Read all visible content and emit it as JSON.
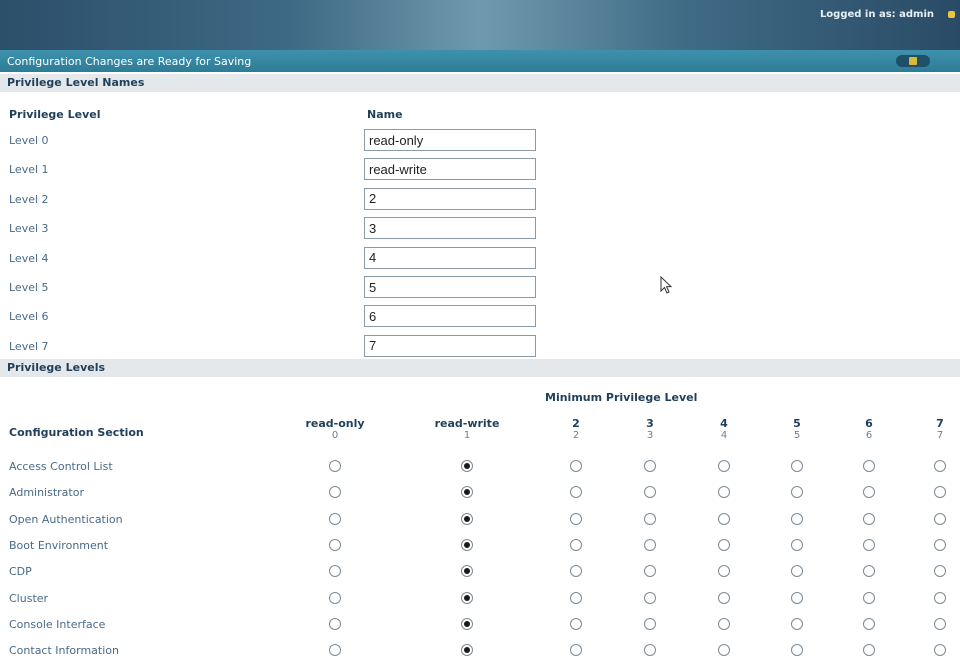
{
  "header": {
    "logged_in": "Logged in as: admin"
  },
  "banner": {
    "text": "Configuration Changes are Ready for Saving"
  },
  "names_section": {
    "title": "Privilege Level Names",
    "col_level": "Privilege Level",
    "col_name": "Name",
    "rows": [
      {
        "label": "Level 0",
        "value": "read-only"
      },
      {
        "label": "Level 1",
        "value": "read-write"
      },
      {
        "label": "Level 2",
        "value": "2"
      },
      {
        "label": "Level 3",
        "value": "3"
      },
      {
        "label": "Level 4",
        "value": "4"
      },
      {
        "label": "Level 5",
        "value": "5"
      },
      {
        "label": "Level 6",
        "value": "6"
      },
      {
        "label": "Level 7",
        "value": "7"
      }
    ]
  },
  "levels_section": {
    "title": "Privilege Levels",
    "min_title": "Minimum Privilege Level",
    "col_config": "Configuration Section",
    "levels": [
      {
        "name": "read-only",
        "num": "0"
      },
      {
        "name": "read-write",
        "num": "1"
      },
      {
        "name": "2",
        "num": "2"
      },
      {
        "name": "3",
        "num": "3"
      },
      {
        "name": "4",
        "num": "4"
      },
      {
        "name": "5",
        "num": "5"
      },
      {
        "name": "6",
        "num": "6"
      },
      {
        "name": "7",
        "num": "7"
      }
    ],
    "rows": [
      {
        "label": "Access Control List",
        "selected": 1
      },
      {
        "label": "Administrator",
        "selected": 1
      },
      {
        "label": "Open Authentication",
        "selected": 1
      },
      {
        "label": "Boot Environment",
        "selected": 1
      },
      {
        "label": "CDP",
        "selected": 1
      },
      {
        "label": "Cluster",
        "selected": 1
      },
      {
        "label": "Console Interface",
        "selected": 1
      },
      {
        "label": "Contact Information",
        "selected": 1
      }
    ]
  }
}
